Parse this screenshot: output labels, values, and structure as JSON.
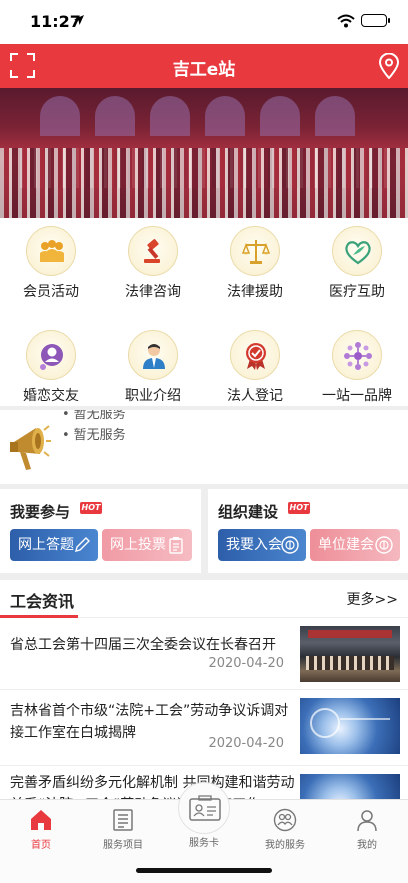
{
  "status_bar": {
    "time": "11:27"
  },
  "header": {
    "title": "吉工e站"
  },
  "grid": [
    {
      "label": "会员活动",
      "icon": "members-group-icon"
    },
    {
      "label": "法律咨询",
      "icon": "gavel-icon"
    },
    {
      "label": "法律援助",
      "icon": "scales-icon"
    },
    {
      "label": "医疗互助",
      "icon": "medical-heart-icon"
    },
    {
      "label": "婚恋交友",
      "icon": "dating-icon"
    },
    {
      "label": "职业介绍",
      "icon": "job-person-icon"
    },
    {
      "label": "法人登记",
      "icon": "seal-badge-icon"
    },
    {
      "label": "一站一品牌",
      "icon": "brand-network-icon"
    }
  ],
  "notice": {
    "line1": "暂无服务",
    "line2": "暂无服务"
  },
  "participate": {
    "title": "我要参与",
    "hot": "HOT",
    "btn1": "网上答题",
    "btn2": "网上投票"
  },
  "organize": {
    "title": "组织建设",
    "hot": "HOT",
    "btn1": "我要入会",
    "btn2": "单位建会"
  },
  "news": {
    "title": "工会资讯",
    "more": "更多>>",
    "items": [
      {
        "title": "省总工会第十四届三次全委会议在长春召开",
        "date": "2020-04-20"
      },
      {
        "title": "吉林省首个市级“法院+工会”劳动争议诉调对接工作室在白城揭牌",
        "date": "2020-04-20"
      },
      {
        "title": "完善矛盾纠纷多元化解机制 共同构建和谐劳动关系“法院+工会”劳动争议诉调对接工作",
        "date": ""
      }
    ]
  },
  "tabbar": {
    "home": "首页",
    "projects": "服务项目",
    "card": "服务卡",
    "my_services": "我的服务",
    "mine": "我的"
  },
  "colors": {
    "brand_red": "#e8393f",
    "button_blue": "#2d5ea9",
    "button_pink": "#f09aa4"
  }
}
